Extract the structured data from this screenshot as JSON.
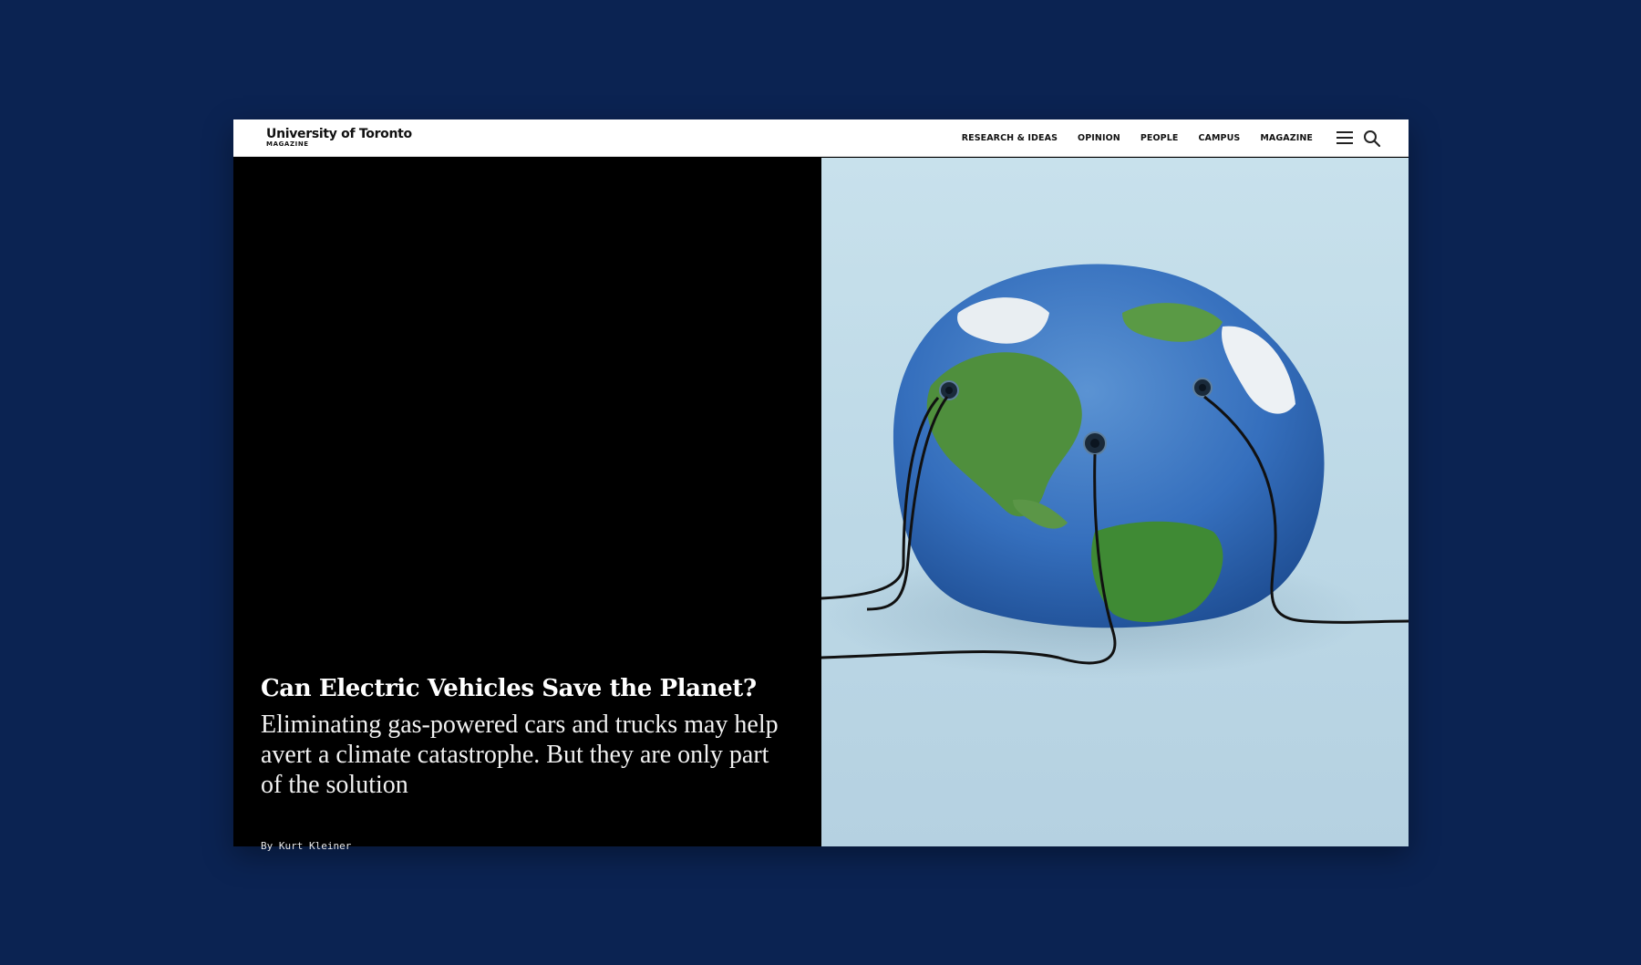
{
  "site": {
    "logo_main": "University of Toronto",
    "logo_sub": "MAGAZINE"
  },
  "nav": {
    "items": [
      "RESEARCH & IDEAS",
      "OPINION",
      "PEOPLE",
      "CAMPUS",
      "MAGAZINE"
    ],
    "menu_icon": "hamburger-menu-icon",
    "search_icon": "search-icon"
  },
  "article": {
    "title": "Can Electric Vehicles Save the Planet?",
    "dek": "Eliminating gas-powered cars and trucks may help avert a climate catastrophe. But they are only part of the solution",
    "byline": "By Kurt Kleiner"
  },
  "colors": {
    "page_background": "#0b2352",
    "hero_left": "#000000",
    "header_background": "#ffffff"
  }
}
